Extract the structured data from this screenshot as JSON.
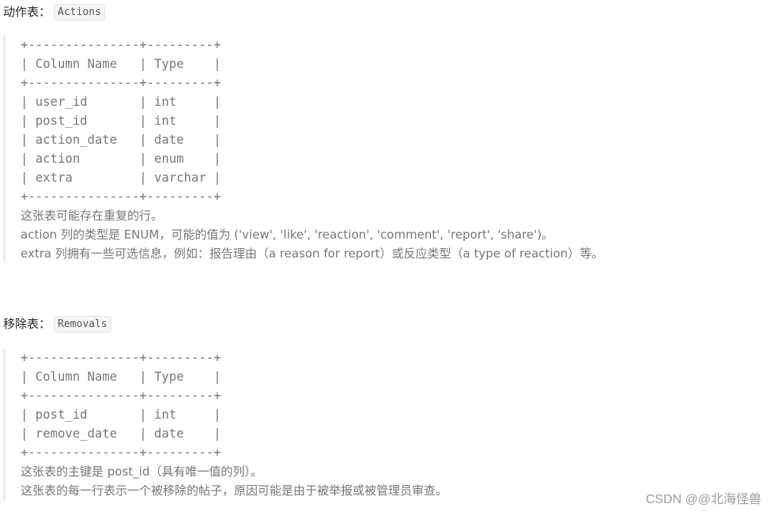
{
  "actions_section": {
    "heading_label": "动作表：",
    "table_name": "Actions",
    "schema": {
      "border": "+---------------+---------+",
      "header": "| Column Name   | Type    |",
      "rows": [
        "| user_id       | int     |",
        "| post_id       | int     |",
        "| action_date   | date    |",
        "| action        | enum    |",
        "| extra         | varchar |"
      ],
      "columns": [
        {
          "name": "user_id",
          "type": "int"
        },
        {
          "name": "post_id",
          "type": "int"
        },
        {
          "name": "action_date",
          "type": "date"
        },
        {
          "name": "action",
          "type": "enum"
        },
        {
          "name": "extra",
          "type": "varchar"
        }
      ]
    },
    "notes": [
      "这张表可能存在重复的行。",
      "action 列的类型是 ENUM，可能的值为 ('view', 'like', 'reaction', 'comment', 'report', 'share')。",
      "extra 列拥有一些可选信息，例如：报告理由（a reason for report）或反应类型（a type of reaction）等。"
    ]
  },
  "removals_section": {
    "heading_label": "移除表：",
    "table_name": "Removals",
    "schema": {
      "border": "+---------------+---------+",
      "header": "| Column Name   | Type    |",
      "rows": [
        "| post_id       | int     |",
        "| remove_date   | date    |"
      ],
      "columns": [
        {
          "name": "post_id",
          "type": "int"
        },
        {
          "name": "remove_date",
          "type": "date"
        }
      ]
    },
    "notes": [
      "这张表的主键是 post_id（具有唯一值的列）。",
      "这张表的每一行表示一个被移除的帖子，原因可能是由于被举报或被管理员审查。"
    ]
  },
  "watermark": "CSDN @@北海怪兽"
}
